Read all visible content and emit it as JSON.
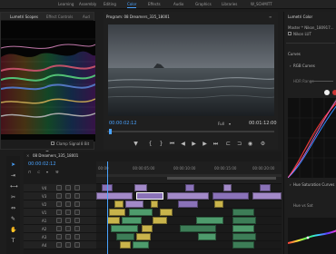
{
  "workspaces": [
    "Learning",
    "Assembly",
    "Editing",
    "Color",
    "Effects",
    "Audio",
    "Graphics",
    "Libraries",
    "W_SCHMITT"
  ],
  "active_workspace": "Color",
  "scopes": {
    "tabs": [
      "Lumetri Scopes",
      "Effect Controls",
      "Aud"
    ],
    "active_tab": "Lumetri Scopes",
    "clamp_label": "Clamp Signal",
    "bit_label": "8 Bit"
  },
  "program": {
    "title": "Program: 08 Dreamers_335_18001",
    "timecode": "00:00:02:12",
    "fit_label": "Full",
    "duration": "00:01:12:00"
  },
  "lumetri": {
    "title": "Lumetri Color",
    "master_label": "Master * Nikon_180917...",
    "clip_label": "Nikon LUT",
    "section_curves": "Curves",
    "section_rgb": "RGB Curves",
    "hdr_label": "HDR Range",
    "section_hue": "Hue Saturation Curves",
    "hue_vs_sat": "Hue vs Sat"
  },
  "timeline": {
    "title": "08 Dreamers_335_18001",
    "timecode": "00:00:02:12",
    "ruler": [
      "00:00",
      "00:00:05:00",
      "00:00:10:00",
      "00:00:15:00",
      "00:00:20:00"
    ],
    "tracks": [
      {
        "id": "V4",
        "kind": "video"
      },
      {
        "id": "V3",
        "kind": "video"
      },
      {
        "id": "V2",
        "kind": "video"
      },
      {
        "id": "V1",
        "kind": "video"
      },
      {
        "id": "A1",
        "kind": "audio"
      },
      {
        "id": "A2",
        "kind": "audio"
      },
      {
        "id": "A3",
        "kind": "audio"
      },
      {
        "id": "A4",
        "kind": "audio"
      }
    ]
  },
  "tools": [
    "selection-tool",
    "track-select-tool",
    "ripple-edit-tool",
    "razor-tool",
    "slip-tool",
    "pen-tool",
    "hand-tool",
    "type-tool"
  ]
}
